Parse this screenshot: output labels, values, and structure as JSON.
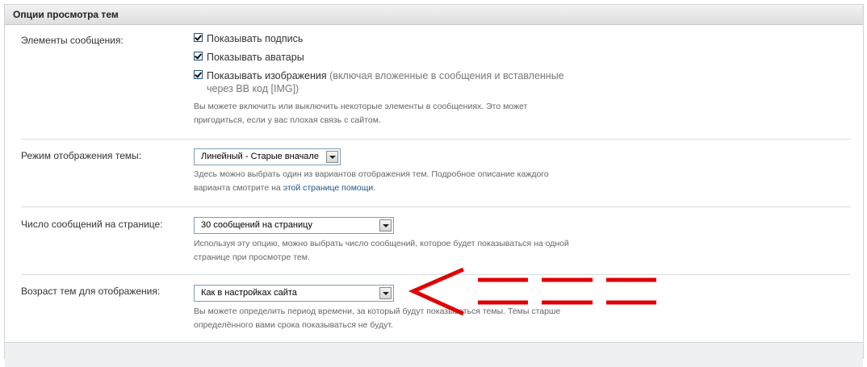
{
  "panel": {
    "title": "Опции просмотра тем"
  },
  "message_elements": {
    "label": "Элементы сообщения:",
    "options": [
      {
        "label": "Показывать подпись",
        "checked": true
      },
      {
        "label": "Показывать аватары",
        "checked": true
      },
      {
        "label": "Показывать изображения",
        "extra": " (включая вложенные в сообщения и вставленные",
        "extra2": "через BB код [IMG])",
        "checked": true
      }
    ],
    "description_line1": "Вы можете включить или выключить некоторые элементы в сообщениях. Это может",
    "description_line2": "пригодиться, если у вас плохая связь с сайтом."
  },
  "thread_mode": {
    "label": "Режим отображения темы:",
    "selected": "Линейный - Старые вначале",
    "description_line1": "Здесь можно выбрать один из вариантов отображения тем. Подробное описание каждого",
    "description_line2_prefix": "варианта смотрите на ",
    "description_link": "этой странице помощи",
    "description_line2_suffix": "."
  },
  "posts_per_page": {
    "label": "Число сообщений на странице:",
    "selected": "30 сообщений на страницу",
    "description_line1": "Используя эту опцию, можно выбрать число сообщений, которое будет показываться на одной",
    "description_line2": "странице при просмотре тем."
  },
  "thread_age": {
    "label": "Возраст тем для отображения:",
    "selected": "Как в настройках сайта",
    "description_line1": "Вы можете определить период времени, за который будут показываться темы. Темы старше",
    "description_line2": "определённого вами срока показываться не будут."
  },
  "annotation": {
    "color": "#e00000",
    "icon": "arrow-annotation-icon"
  }
}
